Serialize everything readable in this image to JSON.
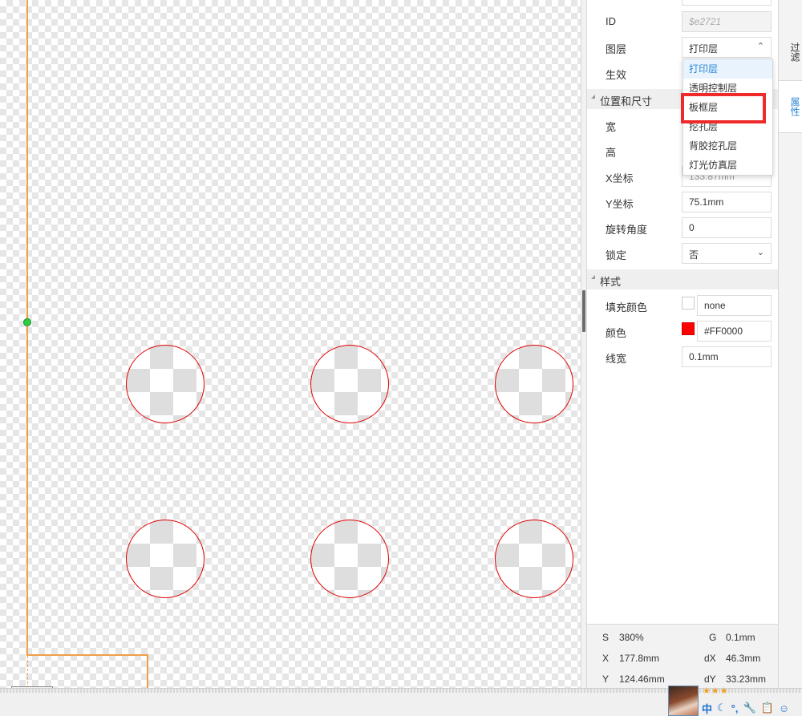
{
  "panel": {
    "fields": {
      "id_label": "ID",
      "id_value": "$e2721",
      "layer_label": "图层",
      "layer_value": "打印层",
      "effective_label": "生效"
    },
    "sections": {
      "position_size": "位置和尺寸",
      "style": "样式"
    },
    "position": {
      "width_label": "宽",
      "height_label": "高",
      "x_label": "X坐标",
      "x_value": "133.87mm",
      "y_label": "Y坐标",
      "y_value": "75.1mm",
      "rotation_label": "旋转角度",
      "rotation_value": "0",
      "lock_label": "锁定",
      "lock_value": "否"
    },
    "style": {
      "fill_label": "填充颜色",
      "fill_value": "none",
      "color_label": "颜色",
      "color_value": "#FF0000",
      "stroke_label": "线宽",
      "stroke_value": "0.1mm"
    }
  },
  "dropdown": {
    "options": [
      "打印层",
      "透明控制层",
      "板框层",
      "挖孔层",
      "背胶挖孔层",
      "灯光仿真层"
    ],
    "selected_index": 0,
    "highlighted_index": 2
  },
  "tabs": {
    "filter": "过滤",
    "properties": "属性"
  },
  "status": {
    "s_label": "S",
    "s_value": "380%",
    "g_label": "G",
    "g_value": "0.1mm",
    "x_label": "X",
    "x_value": "177.8mm",
    "dx_label": "dX",
    "dx_value": "46.3mm",
    "y_label": "Y",
    "y_value": "124.46mm",
    "dy_label": "dY",
    "dy_value": "33.23mm"
  },
  "taskbar": {
    "ime_label": "中"
  },
  "colors": {
    "accent": "#2b86d6",
    "hole_stroke": "#e00000",
    "board_outline": "#f0a048",
    "highlight_box": "#ee2a2a",
    "swatch_red": "#ff0000"
  },
  "icons": [
    "moon-icon",
    "punctuation-icon",
    "wrench-icon",
    "clipboard-icon",
    "smiley-icon",
    "chevron-up-icon",
    "chevron-down-icon",
    "collapse-triangle-icon"
  ]
}
